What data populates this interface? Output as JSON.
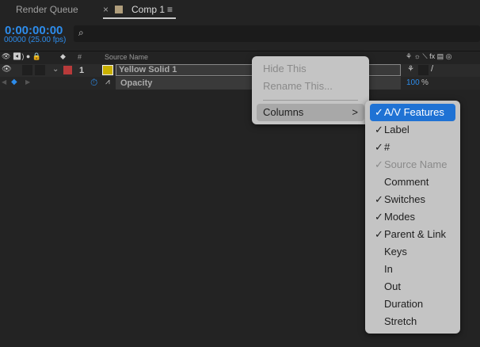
{
  "tabs": {
    "render_queue": "Render Queue",
    "comp": "Comp 1",
    "close": "×",
    "menu": "≡"
  },
  "timecode": "0:00:00:00",
  "fps": "00000 (25.00 fps)",
  "header": {
    "hash": "#",
    "source_name": "Source Name"
  },
  "layer": {
    "index": "1",
    "name": "Yellow Solid 1",
    "label_color": "#b83a3a",
    "solid_color": "#c9b000"
  },
  "property": {
    "name": "Opacity",
    "value": "100",
    "unit": "%"
  },
  "context_menu": {
    "items": [
      {
        "label": "Hide This",
        "enabled": false
      },
      {
        "label": "Rename This...",
        "enabled": false
      },
      {
        "label": "Columns",
        "enabled": true,
        "submenu": true,
        "arrow": ">"
      }
    ]
  },
  "columns_menu": {
    "items": [
      {
        "label": "A/V Features",
        "checked": true,
        "highlighted": true
      },
      {
        "label": "Label",
        "checked": true
      },
      {
        "label": "#",
        "checked": true
      },
      {
        "label": "Source Name",
        "checked": true,
        "disabled": true
      },
      {
        "label": "Comment",
        "checked": false
      },
      {
        "label": "Switches",
        "checked": true
      },
      {
        "label": "Modes",
        "checked": true
      },
      {
        "label": "Parent & Link",
        "checked": true
      },
      {
        "label": "Keys",
        "checked": false
      },
      {
        "label": "In",
        "checked": false
      },
      {
        "label": "Out",
        "checked": false
      },
      {
        "label": "Duration",
        "checked": false
      },
      {
        "label": "Stretch",
        "checked": false
      }
    ],
    "check": "✓"
  }
}
